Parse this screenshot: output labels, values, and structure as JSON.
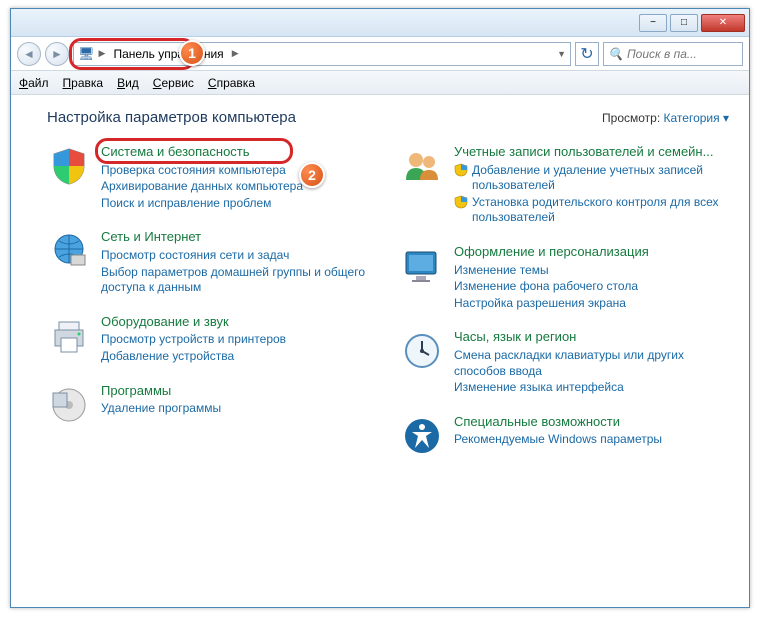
{
  "titlebar": {
    "min": "−",
    "max": "□",
    "close": "✕"
  },
  "breadcrumb": {
    "seg1": "Панель управления"
  },
  "search_placeholder": "Поиск в па...",
  "menu": {
    "file": "Файл",
    "edit": "Правка",
    "view": "Вид",
    "tools": "Сервис",
    "help": "Справка"
  },
  "header": {
    "title": "Настройка параметров компьютера",
    "view_label": "Просмотр:",
    "view_value": "Категория"
  },
  "callouts": {
    "one": "1",
    "two": "2"
  },
  "left": [
    {
      "title": "Система и безопасность",
      "links": [
        "Проверка состояния компьютера",
        "Архивирование данных компьютера",
        "Поиск и исправление проблем"
      ]
    },
    {
      "title": "Сеть и Интернет",
      "links": [
        "Просмотр состояния сети и задач",
        "Выбор параметров домашней группы и общего доступа к данным"
      ]
    },
    {
      "title": "Оборудование и звук",
      "links": [
        "Просмотр устройств и принтеров",
        "Добавление устройства"
      ]
    },
    {
      "title": "Программы",
      "links": [
        "Удаление программы"
      ]
    }
  ],
  "right": [
    {
      "title": "Учетные записи пользователей и семейн...",
      "links": [
        {
          "shield": true,
          "text": "Добавление и удаление учетных записей пользователей"
        },
        {
          "shield": true,
          "text": "Установка родительского контроля для всех пользователей"
        }
      ]
    },
    {
      "title": "Оформление и персонализация",
      "links": [
        {
          "text": "Изменение темы"
        },
        {
          "text": "Изменение фона рабочего стола"
        },
        {
          "text": "Настройка разрешения экрана"
        }
      ]
    },
    {
      "title": "Часы, язык и регион",
      "links": [
        {
          "text": "Смена раскладки клавиатуры или других способов ввода"
        },
        {
          "text": "Изменение языка интерфейса"
        }
      ]
    },
    {
      "title": "Специальные возможности",
      "links": [
        {
          "text": "Рекомендуемые Windows параметры"
        }
      ]
    }
  ]
}
